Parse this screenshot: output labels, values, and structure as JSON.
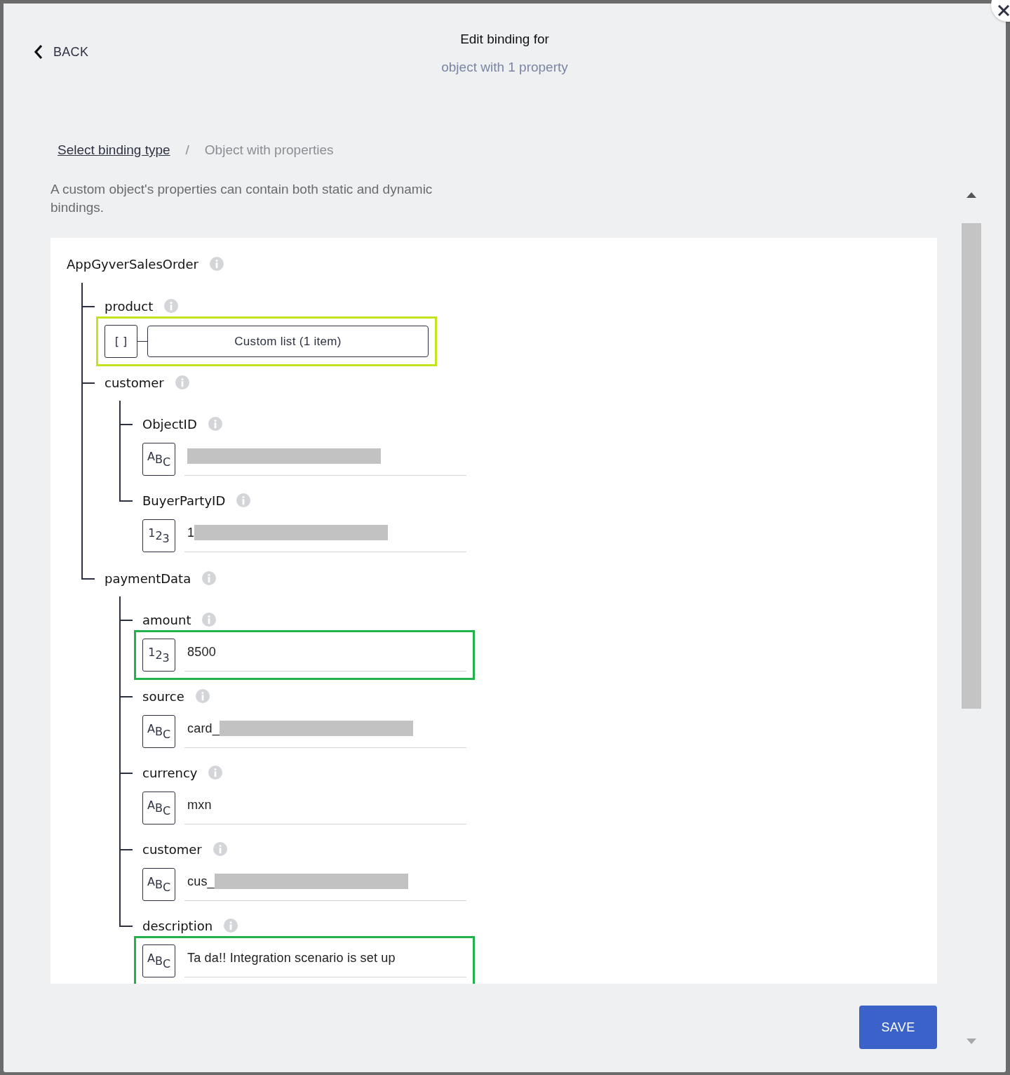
{
  "header": {
    "back": "BACK",
    "title": "Edit binding for",
    "subtitle": "object with 1 property"
  },
  "breadcrumb": {
    "link": "Select binding type",
    "separator": "/",
    "current": "Object with properties"
  },
  "description": "A custom object's properties can contain both static and dynamic bindings.",
  "tree": {
    "name": "AppGyverSalesOrder",
    "children": [
      {
        "name": "product",
        "kind": "list",
        "badge": "[ ]",
        "value": "Custom list (1 item)",
        "color": "#c2e41c"
      },
      {
        "name": "customer",
        "kind": "object",
        "children": [
          {
            "name": "ObjectID",
            "kind": "value",
            "badge": "ABC",
            "redacted": true
          },
          {
            "name": "BuyerPartyID",
            "kind": "value",
            "badge": "123",
            "value": "1",
            "redacted": true
          }
        ]
      },
      {
        "name": "paymentData",
        "kind": "object",
        "children": [
          {
            "name": "amount",
            "kind": "value",
            "badge": "123",
            "value": "8500",
            "redacted": false,
            "color": "#22b24c"
          },
          {
            "name": "source",
            "kind": "value",
            "badge": "ABC",
            "value": "card_",
            "redacted": true
          },
          {
            "name": "currency",
            "kind": "value",
            "badge": "ABC",
            "value": "mxn",
            "redacted": false
          },
          {
            "name": "customer",
            "kind": "value",
            "badge": "ABC",
            "value": "cus_",
            "redacted": true
          },
          {
            "name": "description",
            "kind": "value",
            "badge": "ABC",
            "value": "Ta da!! Integration scenario is set up",
            "redacted": false,
            "color": "#22b24c"
          }
        ]
      }
    ]
  },
  "save": "SAVE"
}
